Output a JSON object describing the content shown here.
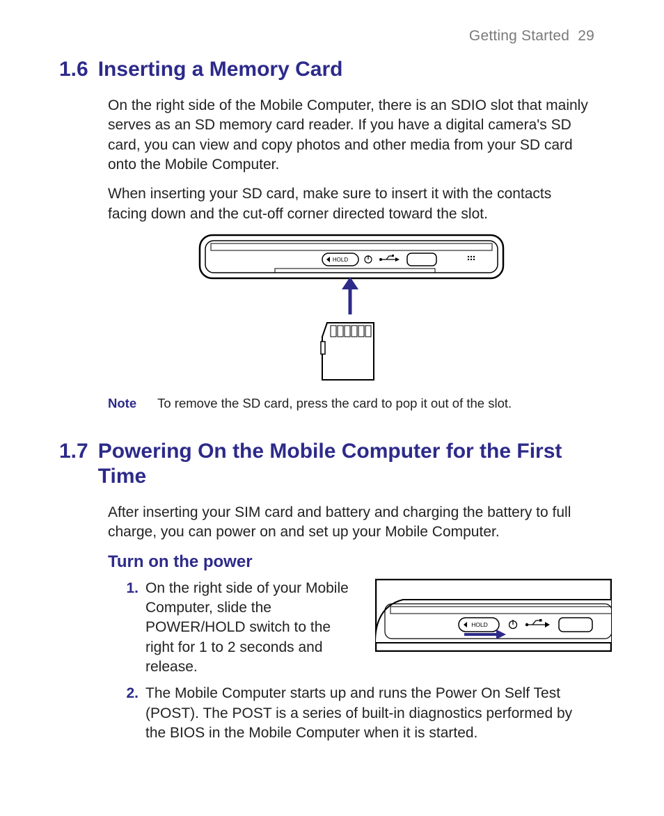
{
  "header": {
    "section": "Getting Started",
    "page": "29"
  },
  "s16": {
    "num": "1.6",
    "title": "Inserting a Memory Card",
    "p1": "On the right side of the Mobile Computer, there is an SDIO slot that mainly serves as an SD memory card reader. If you have a digital camera's SD card, you can view and copy photos and other media from your SD card onto the Mobile Computer.",
    "p2": "When inserting your SD card, make sure to insert it with the contacts facing down and the cut-off corner directed toward the slot.",
    "note_label": "Note",
    "note_text": "To remove the SD card, press the card to pop it out of the slot."
  },
  "s17": {
    "num": "1.7",
    "title": "Powering On the Mobile Computer for the First Time",
    "p1": "After inserting your SIM card and battery and charging the battery to full charge, you can power on and set up your Mobile Computer.",
    "sub": "Turn on the power",
    "steps": [
      {
        "num": "1.",
        "text": "On the right side of your Mobile Computer, slide the POWER/HOLD switch to the right for 1 to 2 seconds and release."
      },
      {
        "num": "2.",
        "text": "The Mobile Computer starts up and runs the Power On Self Test (POST). The POST is a series of built-in diagnostics performed by the BIOS in the Mobile Computer when it is started."
      }
    ]
  },
  "fig1": {
    "hold_label": "HOLD"
  },
  "fig2": {
    "hold_label": "HOLD"
  }
}
